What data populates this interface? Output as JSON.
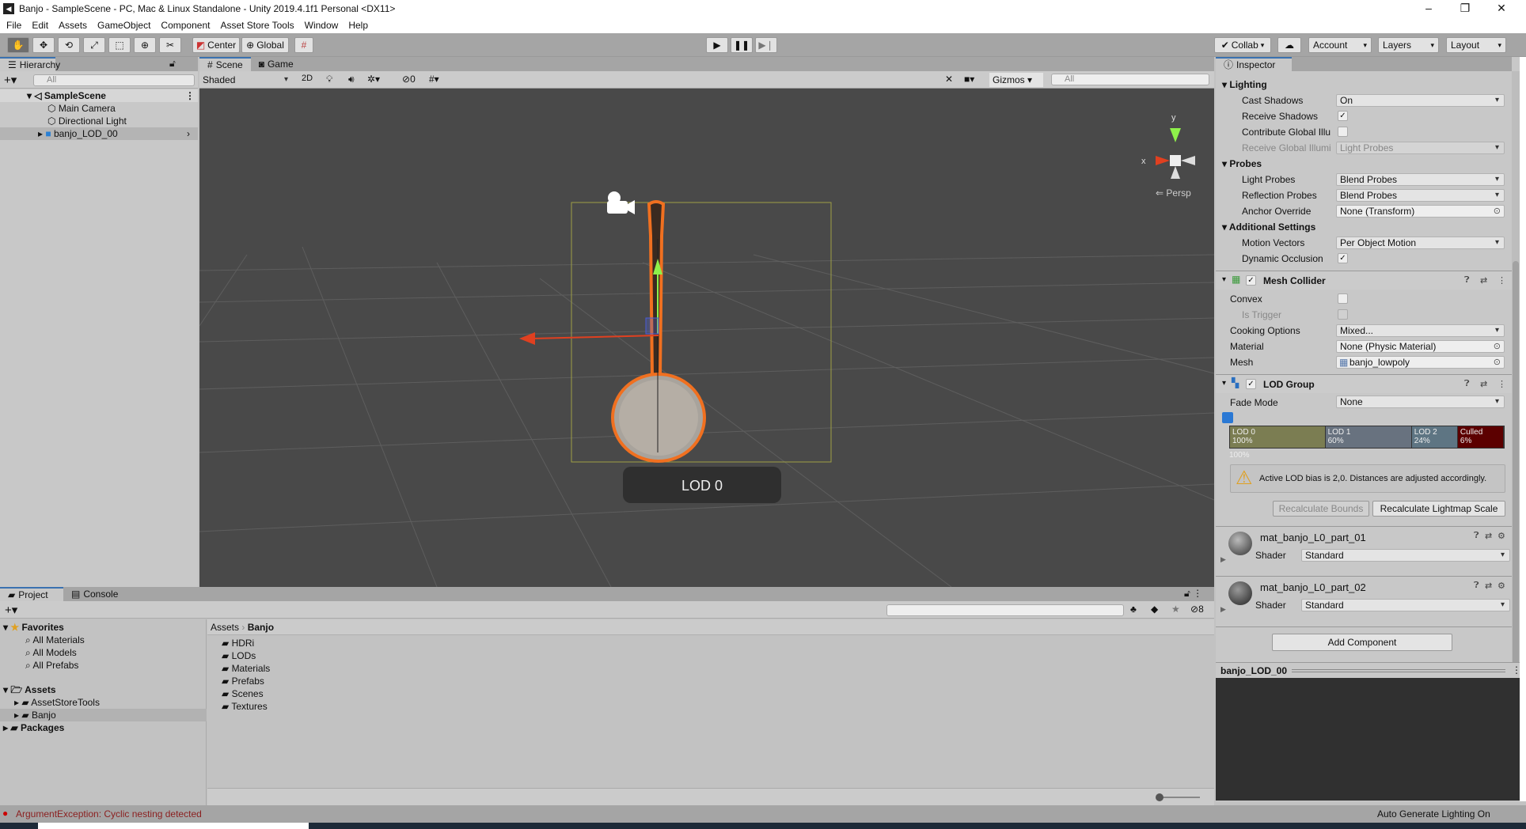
{
  "window": {
    "title": "Banjo - SampleScene - PC, Mac & Linux Standalone - Unity 2019.4.1f1 Personal <DX11>",
    "minimize": "–",
    "maximize": "❐",
    "close": "✕"
  },
  "menu": [
    "File",
    "Edit",
    "Assets",
    "GameObject",
    "Component",
    "Asset Store Tools",
    "Window",
    "Help"
  ],
  "toolbar": {
    "pivot": "Center",
    "space": "Global",
    "collab": "Collab",
    "account": "Account",
    "layers": "Layers",
    "layout": "Layout"
  },
  "hierarchy": {
    "tab": "Hierarchy",
    "search_placeholder": "All",
    "scene": "SampleScene",
    "items": [
      "Main Camera",
      "Directional Light",
      "banjo_LOD_00"
    ]
  },
  "scene": {
    "tabs": [
      "Scene",
      "Game"
    ],
    "shading": "Shaded",
    "mode2d": "2D",
    "hidden_count": "0",
    "gizmos": "Gizmos",
    "search_placeholder": "All",
    "persp": "Persp",
    "axis_x": "x",
    "axis_y": "y",
    "lod_label": "LOD 0"
  },
  "inspector": {
    "tab": "Inspector",
    "lighting": {
      "title": "Lighting",
      "cast_shadows": {
        "label": "Cast Shadows",
        "value": "On"
      },
      "receive_shadows": {
        "label": "Receive Shadows",
        "checked": true
      },
      "contribute_gi": {
        "label": "Contribute Global Illu",
        "checked": false
      },
      "receive_gi": {
        "label": "Receive Global Illumi",
        "value": "Light Probes"
      }
    },
    "probes": {
      "title": "Probes",
      "light_probes": {
        "label": "Light Probes",
        "value": "Blend Probes"
      },
      "reflection_probes": {
        "label": "Reflection Probes",
        "value": "Blend Probes"
      },
      "anchor_override": {
        "label": "Anchor Override",
        "value": "None (Transform)"
      }
    },
    "additional": {
      "title": "Additional Settings",
      "motion_vectors": {
        "label": "Motion Vectors",
        "value": "Per Object Motion"
      },
      "dynamic_occlusion": {
        "label": "Dynamic Occlusion",
        "checked": true
      }
    },
    "mesh_collider": {
      "title": "Mesh Collider",
      "convex": "Convex",
      "is_trigger": "Is Trigger",
      "cooking": {
        "label": "Cooking Options",
        "value": "Mixed..."
      },
      "material": {
        "label": "Material",
        "value": "None (Physic Material)"
      },
      "mesh": {
        "label": "Mesh",
        "value": "banjo_lowpoly"
      }
    },
    "lod_group": {
      "title": "LOD Group",
      "fade_mode": {
        "label": "Fade Mode",
        "value": "None"
      },
      "levels": [
        {
          "name": "LOD 0",
          "pct": "100%",
          "value": 100,
          "color": "#7b7d52"
        },
        {
          "name": "LOD 1",
          "pct": "60%",
          "value": 60,
          "color": "#68727f"
        },
        {
          "name": "LOD 2",
          "pct": "24%",
          "value": 24,
          "color": "#5e7583"
        },
        {
          "name": "Culled",
          "pct": "6%",
          "value": 6,
          "color": "#5c0000"
        }
      ],
      "slider_label": "100%",
      "warning": "Active LOD bias is 2,0. Distances are adjusted accordingly.",
      "recalc_bounds": "Recalculate Bounds",
      "recalc_lightmap": "Recalculate Lightmap Scale"
    },
    "materials": [
      {
        "name": "mat_banjo_L0_part_01",
        "shader_label": "Shader",
        "shader": "Standard"
      },
      {
        "name": "mat_banjo_L0_part_02",
        "shader_label": "Shader",
        "shader": "Standard"
      }
    ],
    "add_component": "Add Component",
    "preview_title": "banjo_LOD_00"
  },
  "project": {
    "tabs": [
      "Project",
      "Console"
    ],
    "favorites": "Favorites",
    "fav_items": [
      "All Materials",
      "All Models",
      "All Prefabs"
    ],
    "assets": "Assets",
    "asset_items": [
      "AssetStoreTools",
      "Banjo"
    ],
    "packages": "Packages",
    "breadcrumb": [
      "Assets",
      "Banjo"
    ],
    "folders": [
      "HDRi",
      "LODs",
      "Materials",
      "Prefabs",
      "Scenes",
      "Textures"
    ],
    "hidden_count": "8"
  },
  "status": {
    "error": "ArgumentException: Cyclic nesting detected",
    "lighting": "Auto Generate Lighting On"
  }
}
